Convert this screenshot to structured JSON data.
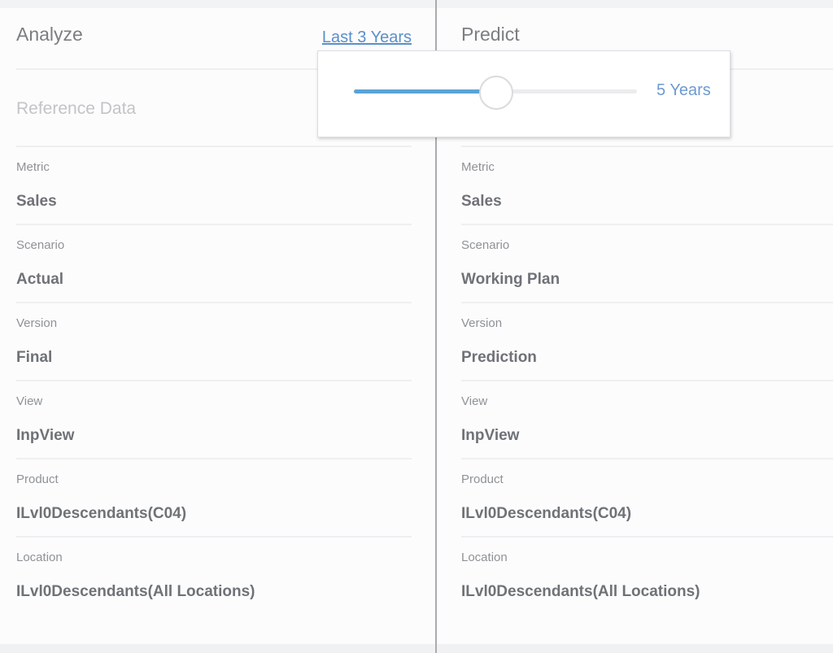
{
  "analyze": {
    "title": "Analyze",
    "range_link": "Last 3 Years",
    "reference_label": "Reference Data",
    "fields": [
      {
        "label": "Metric",
        "value": "Sales"
      },
      {
        "label": "Scenario",
        "value": "Actual"
      },
      {
        "label": "Version",
        "value": "Final"
      },
      {
        "label": "View",
        "value": "InpView"
      },
      {
        "label": "Product",
        "value": "ILvl0Descendants(C04)"
      },
      {
        "label": "Location",
        "value": "ILvl0Descendants(All Locations)"
      }
    ]
  },
  "predict": {
    "title": "Predict",
    "fields": [
      {
        "label": "Metric",
        "value": "Sales"
      },
      {
        "label": "Scenario",
        "value": "Working Plan"
      },
      {
        "label": "Version",
        "value": "Prediction"
      },
      {
        "label": "View",
        "value": "InpView"
      },
      {
        "label": "Product",
        "value": "ILvl0Descendants(C04)"
      },
      {
        "label": "Location",
        "value": "ILvl0Descendants(All Locations)"
      }
    ]
  },
  "range_popup": {
    "value_label": "5 Years",
    "slider_fraction": 0.5,
    "fill_color": "#5ba3d6"
  },
  "colors": {
    "link": "#5b8fc9",
    "divider": "#a9abae"
  }
}
